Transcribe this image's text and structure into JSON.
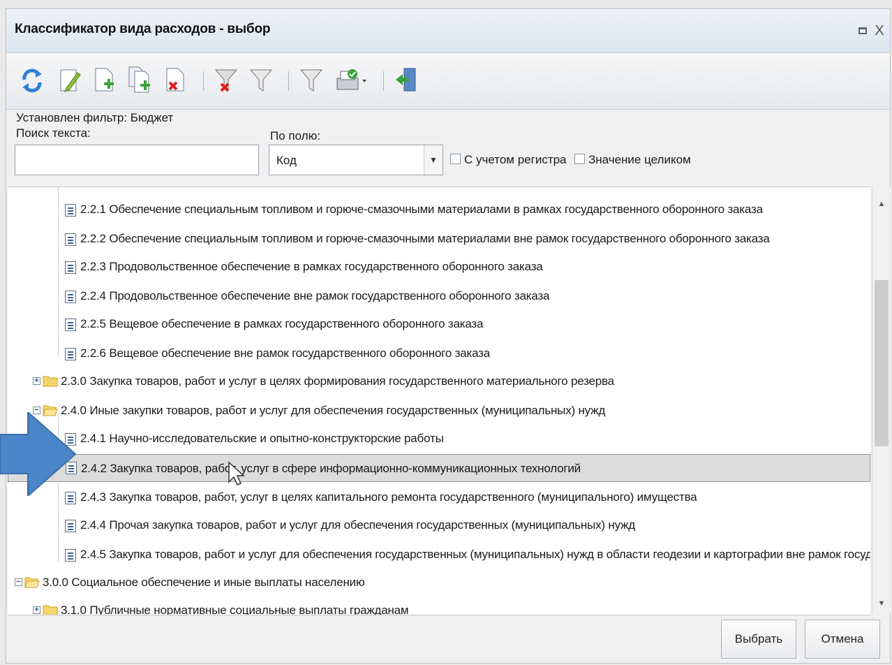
{
  "window": {
    "title": "Классификатор вида расходов - выбор",
    "maximize_label": "",
    "close_label": "X"
  },
  "toolbar": {
    "icons": [
      "refresh-icon",
      "edit-icon",
      "add-icon",
      "copy-add-icon",
      "delete-icon",
      "clear-filter-icon",
      "filter-icon",
      "filter-settings-icon",
      "print-icon",
      "exit-icon"
    ]
  },
  "filter": {
    "status": "Установлен фильтр: Бюджет",
    "search_label": "Поиск текста:",
    "search_value": "",
    "field_label": "По полю:",
    "field_value": "Код",
    "case_label": "С учетом регистра",
    "whole_label": "Значение целиком"
  },
  "tree": {
    "rows": [
      {
        "text": "2.2.1 Обеспечение специальным топливом и горюче-смазочными материалами в рамках государственного оборонного заказа",
        "type": "doc"
      },
      {
        "text": "2.2.2 Обеспечение специальным топливом и горюче-смазочными материалами вне рамок государственного оборонного заказа",
        "type": "doc"
      },
      {
        "text": "2.2.3 Продовольственное обеспечение в рамках государственного оборонного заказа",
        "type": "doc"
      },
      {
        "text": "2.2.4 Продовольственное обеспечение вне рамок государственного оборонного заказа",
        "type": "doc"
      },
      {
        "text": "2.2.5 Вещевое обеспечение в рамках государственного оборонного заказа",
        "type": "doc"
      },
      {
        "text": "2.2.6 Вещевое обеспечение вне рамок государственного оборонного заказа",
        "type": "doc"
      },
      {
        "text": "2.3.0 Закупка товаров, работ и услуг в целях формирования государственного материального резерва",
        "type": "folder"
      },
      {
        "text": "2.4.0 Иные закупки товаров, работ и услуг для обеспечения государственных (муниципальных) нужд",
        "type": "folder-open"
      },
      {
        "text": "2.4.1 Научно-исследовательские и опытно-конструкторские работы",
        "type": "doc"
      },
      {
        "text": "2.4.2 Закупка товаров, работ, услуг в сфере информационно-коммуникационных технологий",
        "type": "doc"
      },
      {
        "text": "2.4.3 Закупка товаров, работ, услуг в целях капитального ремонта государственного (муниципального) имущества",
        "type": "doc"
      },
      {
        "text": "2.4.4 Прочая закупка товаров, работ и услуг для обеспечения государственных (муниципальных) нужд",
        "type": "doc"
      },
      {
        "text": "2.4.5 Закупка товаров, работ и услуг для обеспечения государственных (муниципальных) нужд в области геодезии и картографии вне рамок госуд",
        "type": "doc"
      },
      {
        "text": "3.0.0 Социальное обеспечение и иные выплаты населению",
        "type": "folder-open"
      },
      {
        "text": "3.1.0 Публичные нормативные социальные выплаты гражданам",
        "type": "folder"
      }
    ]
  },
  "buttons": {
    "select": "Выбрать",
    "cancel": "Отмена"
  }
}
